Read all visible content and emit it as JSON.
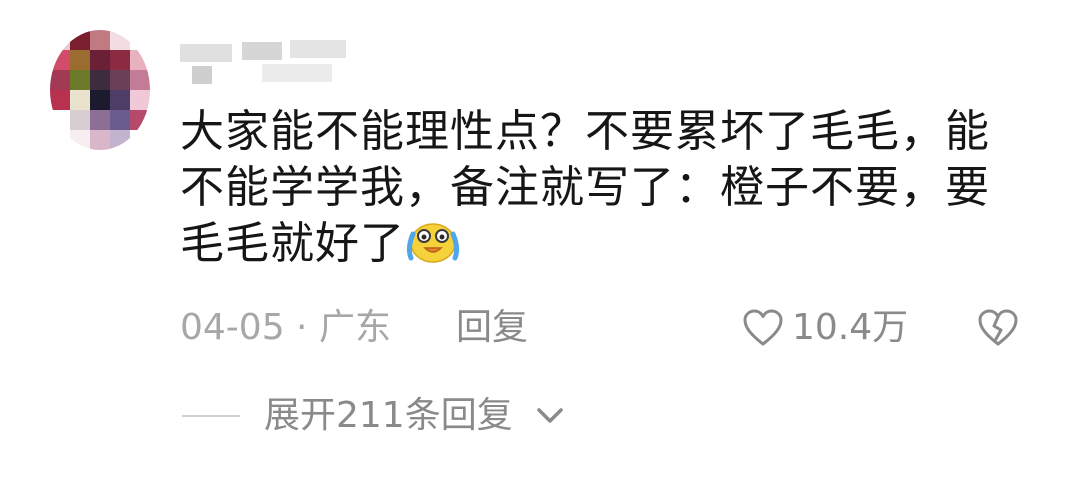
{
  "comment": {
    "text_part1": "大家能不能理性点？不要累坏了毛毛，能不能学学我，备注就写了：橙子不要，要毛毛就好了",
    "emoji": "laughing-crying-emoji"
  },
  "meta": {
    "date_location": "04-05 · 广东",
    "reply_label": "回复",
    "like_count": "10.4万"
  },
  "replies": {
    "expand_label": "展开211条回复"
  },
  "colors": {
    "text_primary": "#161616",
    "text_secondary": "#8a8a8a",
    "text_muted": "#a7a7a7",
    "emoji_face": "#f6d23a"
  },
  "icons": {
    "like": "heart-outline-icon",
    "dislike": "broken-heart-icon",
    "expand": "chevron-down-icon"
  }
}
